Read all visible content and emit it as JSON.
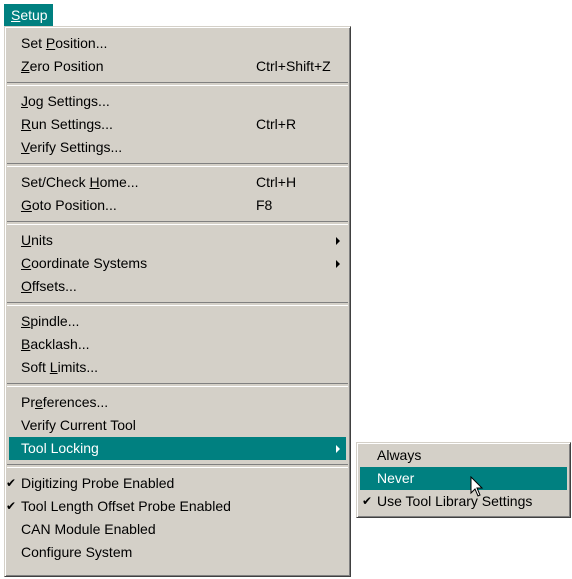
{
  "menubar": {
    "title_pre": "",
    "title_u": "S",
    "title_post": "etup"
  },
  "menu": {
    "set_position": {
      "pre": "Set ",
      "u": "P",
      "post": "osition..."
    },
    "zero_position": {
      "pre": "",
      "u": "Z",
      "post": "ero Position",
      "shortcut": "Ctrl+Shift+Z"
    },
    "jog_settings": {
      "pre": "",
      "u": "J",
      "post": "og Settings..."
    },
    "run_settings": {
      "pre": "",
      "u": "R",
      "post": "un Settings...",
      "shortcut": "Ctrl+R"
    },
    "verify_settings": {
      "pre": "",
      "u": "V",
      "post": "erify Settings..."
    },
    "set_check_home": {
      "pre": "Set/Check ",
      "u": "H",
      "post": "ome...",
      "shortcut": "Ctrl+H"
    },
    "goto_position": {
      "pre": "",
      "u": "G",
      "post": "oto Position...",
      "shortcut": "F8"
    },
    "units": {
      "pre": "",
      "u": "U",
      "post": "nits"
    },
    "coordinate_systems": {
      "pre": "",
      "u": "C",
      "post": "oordinate Systems"
    },
    "offsets": {
      "pre": "",
      "u": "O",
      "post": "ffsets..."
    },
    "spindle": {
      "pre": "",
      "u": "S",
      "post": "pindle..."
    },
    "backlash": {
      "pre": "",
      "u": "B",
      "post": "acklash..."
    },
    "soft_limits": {
      "pre": "Soft ",
      "u": "L",
      "post": "imits..."
    },
    "preferences": {
      "pre": "Pr",
      "u": "e",
      "post": "ferences..."
    },
    "verify_current_tool": {
      "label": "Verify Current Tool"
    },
    "tool_locking": {
      "label": "Tool Locking"
    },
    "digitizing_probe": {
      "label": "Digitizing Probe Enabled",
      "check": "✔"
    },
    "tool_length_probe": {
      "label": "Tool Length Offset Probe Enabled",
      "check": "✔"
    },
    "can_module": {
      "label": "CAN Module Enabled"
    },
    "configure_system": {
      "label": "Configure System"
    }
  },
  "submenu": {
    "always": "Always",
    "never": "Never",
    "use_library": "Use Tool Library Settings",
    "use_library_check": "✔"
  }
}
